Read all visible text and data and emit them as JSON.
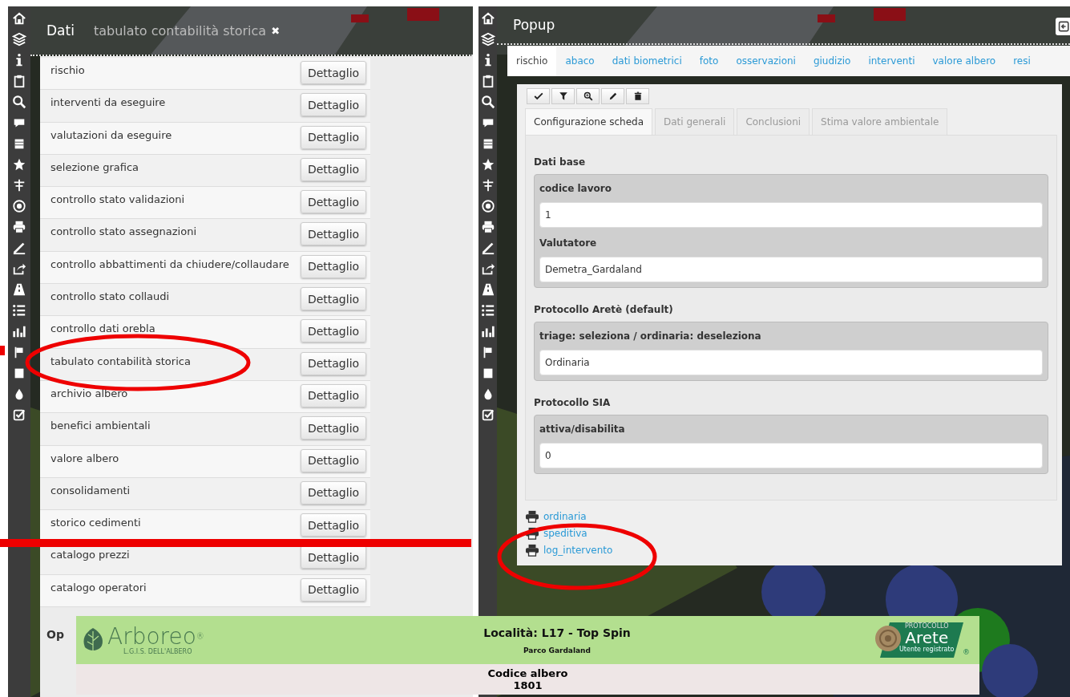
{
  "left_panel": {
    "title": "Dati",
    "open_tab": {
      "label": "tabulato contabilità storica",
      "close": "✖"
    },
    "rows": [
      {
        "label": "rischio",
        "button": "Dettaglio"
      },
      {
        "label": "interventi da eseguire",
        "button": "Dettaglio"
      },
      {
        "label": "valutazioni da eseguire",
        "button": "Dettaglio"
      },
      {
        "label": "selezione grafica",
        "button": "Dettaglio"
      },
      {
        "label": "controllo stato validazioni",
        "button": "Dettaglio"
      },
      {
        "label": "controllo stato assegnazioni",
        "button": "Dettaglio"
      },
      {
        "label": "controllo abbattimenti da chiudere/collaudare",
        "button": "Dettaglio"
      },
      {
        "label": "controllo stato collaudi",
        "button": "Dettaglio"
      },
      {
        "label": "controllo dati orebla",
        "button": "Dettaglio"
      },
      {
        "label": "tabulato contabilità storica",
        "button": "Dettaglio"
      },
      {
        "label": "archivio albero",
        "button": "Dettaglio"
      },
      {
        "label": "benefici ambientali",
        "button": "Dettaglio"
      },
      {
        "label": "valore albero",
        "button": "Dettaglio"
      },
      {
        "label": "consolidamenti",
        "button": "Dettaglio"
      },
      {
        "label": "storico cedimenti",
        "button": "Dettaglio"
      },
      {
        "label": "catalogo prezzi",
        "button": "Dettaglio"
      },
      {
        "label": "catalogo operatori",
        "button": "Dettaglio"
      }
    ],
    "footer_text": "Op"
  },
  "right_panel": {
    "title": "Popup",
    "tabs": [
      {
        "label": "rischio",
        "selected": true
      },
      {
        "label": "abaco",
        "selected": false
      },
      {
        "label": "dati biometrici",
        "selected": false
      },
      {
        "label": "foto",
        "selected": false
      },
      {
        "label": "osservazioni",
        "selected": false
      },
      {
        "label": "giudizio",
        "selected": false
      },
      {
        "label": "interventi",
        "selected": false
      },
      {
        "label": "valore albero",
        "selected": false
      },
      {
        "label": "resi",
        "selected": false
      }
    ],
    "subtabs": [
      {
        "label": "Configurazione scheda",
        "selected": true
      },
      {
        "label": "Dati generali",
        "selected": false
      },
      {
        "label": "Conclusioni",
        "selected": false
      },
      {
        "label": "Stima valore ambientale",
        "selected": false
      }
    ],
    "sections": [
      {
        "title": "Dati base",
        "fields": [
          {
            "label": "codice lavoro",
            "value": "1"
          },
          {
            "label": "Valutatore",
            "value": "Demetra_Gardaland"
          }
        ]
      },
      {
        "title": "Protocollo Aretè (default)",
        "fields": [
          {
            "label": "triage: seleziona / ordinaria: deseleziona",
            "value": "Ordinaria"
          }
        ]
      },
      {
        "title": "Protocollo SIA",
        "fields": [
          {
            "label": "attiva/disabilita",
            "value": "0"
          }
        ]
      }
    ],
    "print_links": [
      "ordinaria",
      "speditiva",
      "log_intervento"
    ]
  },
  "banner": {
    "logo_left": "Arboreo",
    "logo_left_mark": "®",
    "logo_left_tagline": "L.G.I.S. DELL'ALBERO",
    "title": "Località: L17 - Top Spin",
    "subtitle": "Parco Gardaland",
    "logo_right_top": "PROTOCOLLO",
    "logo_right": "Arete",
    "logo_right_bottom": "Utente registrato",
    "logo_right_mark": "®",
    "code_label": "Codice albero",
    "code": "1801"
  }
}
